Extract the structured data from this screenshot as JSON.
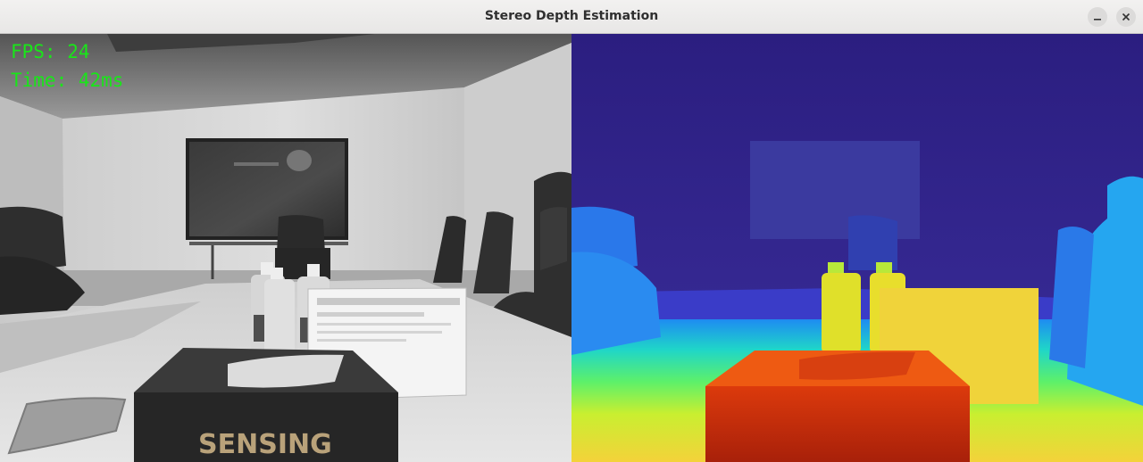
{
  "window": {
    "title": "Stereo Depth Estimation",
    "controls": [
      "minimize-icon",
      "close-icon"
    ]
  },
  "left_view": {
    "stats": {
      "fps_label": "FPS:",
      "fps_value": "24",
      "time_label": "Time:",
      "time_value": "42ms"
    },
    "overlay_color": "#19e619",
    "tissue_box_brand": "SENSING"
  },
  "right_view": {
    "colormap": "turbo"
  }
}
